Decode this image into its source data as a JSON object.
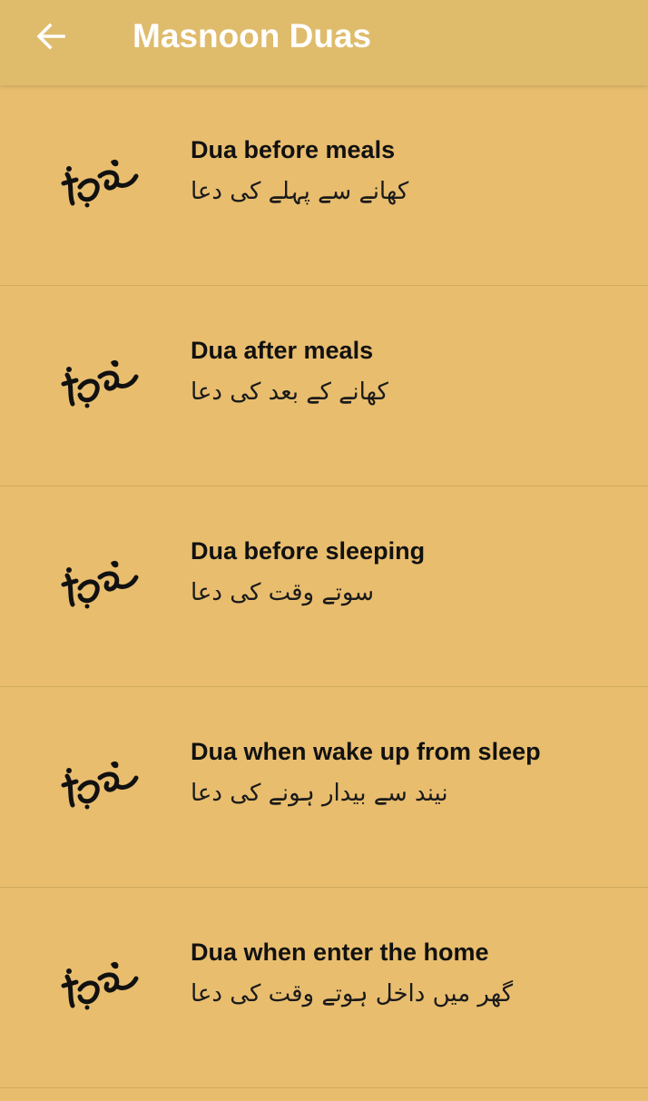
{
  "app_bar": {
    "back_icon": "arrow-left-icon",
    "title": "Masnoon Duas"
  },
  "colors": {
    "app_bar_bg": "#dfbb6c",
    "list_bg": "#e8bd6e",
    "title_text": "#ffffff",
    "item_text": "#111111",
    "divider": "#cfa95e"
  },
  "items": [
    {
      "title": "Dua before meals",
      "urdu": "کھانے سے پہلے کی دعا",
      "icon": "dua-calligraphy-icon"
    },
    {
      "title": "Dua after meals",
      "urdu": "کھانے کے بعد کی دعا",
      "icon": "dua-calligraphy-icon"
    },
    {
      "title": "Dua before sleeping",
      "urdu": "سوتے وقت کی دعا",
      "icon": "dua-calligraphy-icon"
    },
    {
      "title": "Dua when wake up from sleep",
      "urdu": "نیند سے بیدار ہونے کی دعا",
      "icon": "dua-calligraphy-icon"
    },
    {
      "title": "Dua when enter the home",
      "urdu": "گھر میں داخل ہوتے وقت کی دعا",
      "icon": "dua-calligraphy-icon"
    }
  ]
}
